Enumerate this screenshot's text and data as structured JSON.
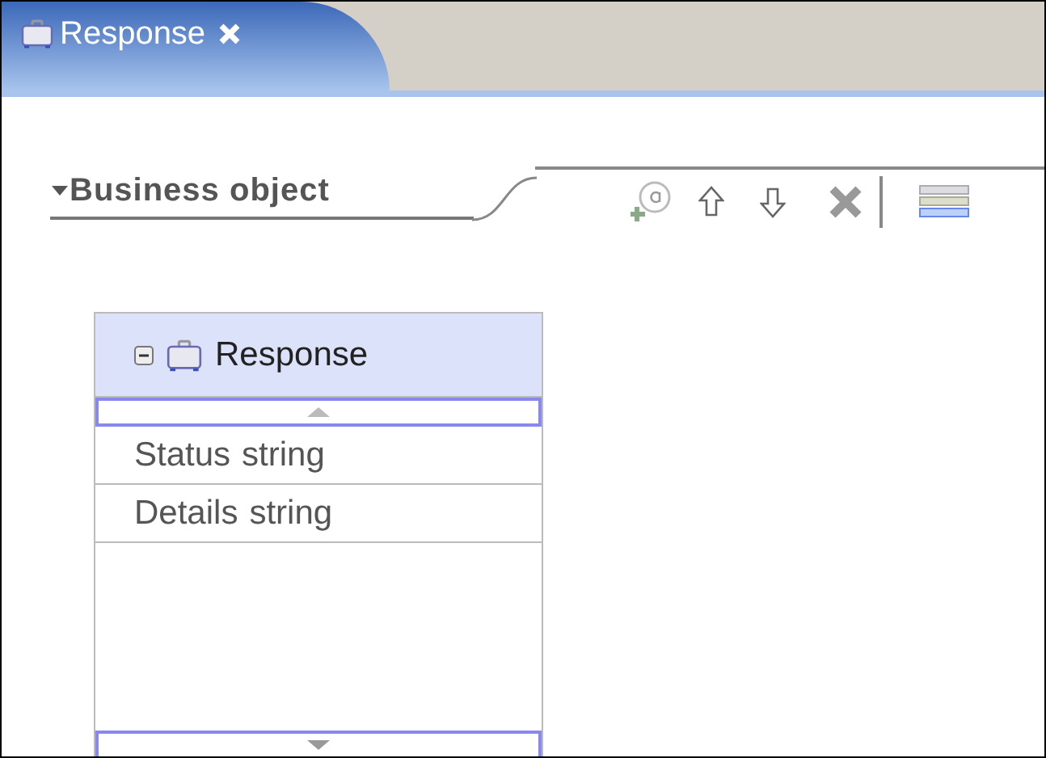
{
  "tab": {
    "title": "Response",
    "selected": true
  },
  "section": {
    "title": "Business object",
    "expanded": true
  },
  "business_object": {
    "name": "Response",
    "expanded": true,
    "attributes": [
      {
        "name": "Status",
        "type": "string"
      },
      {
        "name": "Details",
        "type": "string"
      }
    ]
  }
}
